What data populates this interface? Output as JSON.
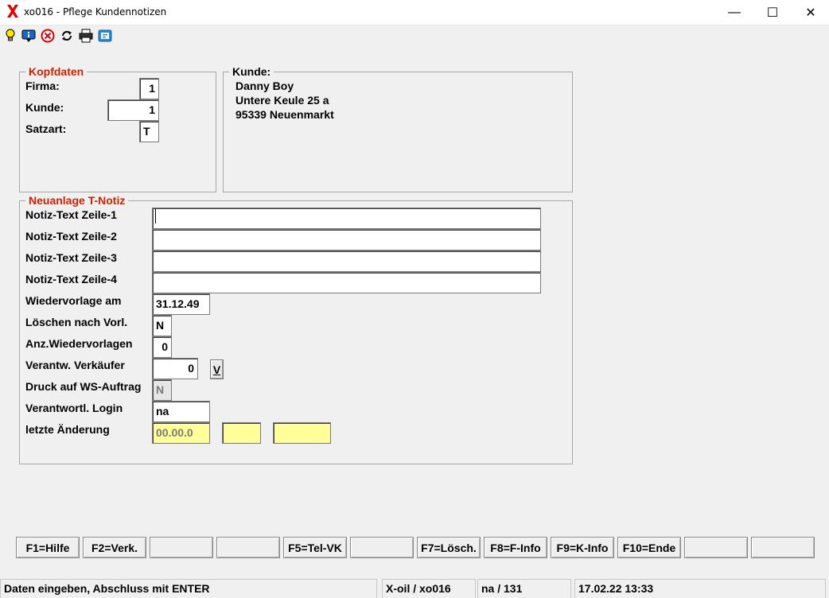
{
  "window": {
    "title": "xo016 - Pflege Kundennotizen",
    "minimize_glyph": "—",
    "maximize_glyph": "☐",
    "close_glyph": "✕"
  },
  "toolbar": {
    "icons": [
      "lightbulb-icon",
      "info-screen-icon",
      "cancel-icon",
      "refresh-icon",
      "print-icon",
      "help-window-icon"
    ]
  },
  "kopfdaten": {
    "legend": "Kopfdaten",
    "firma_label": "Firma:",
    "firma_value": "1",
    "kunde_label": "Kunde:",
    "kunde_value": "1",
    "satzart_label": "Satzart:",
    "satzart_value": "T"
  },
  "kunde": {
    "legend": "Kunde:",
    "name": "Danny Boy",
    "street": "Untere Keule 25 a",
    "city": "95339 Neuenmarkt"
  },
  "notiz": {
    "legend": "Neuanlage T-Notiz",
    "zeile1_label": "Notiz-Text Zeile-1",
    "zeile1_value": "",
    "zeile2_label": "Notiz-Text Zeile-2",
    "zeile2_value": "",
    "zeile3_label": "Notiz-Text Zeile-3",
    "zeile3_value": "",
    "zeile4_label": "Notiz-Text Zeile-4",
    "zeile4_value": "",
    "wiedervorlage_label": "Wiedervorlage am",
    "wiedervorlage_value": "31.12.49",
    "loeschen_label": "Löschen nach Vorl.",
    "loeschen_value": "N",
    "anz_label": "Anz.Wiedervorlagen",
    "anz_value": "0",
    "verkaeufer_label": "Verantw. Verkäufer",
    "verkaeufer_value": "0",
    "verkaeufer_button": "V",
    "druck_label": "Druck auf WS-Auftrag",
    "druck_value": "N",
    "login_label": "Verantwortl. Login",
    "login_value": "na",
    "aenderung_label": "letzte Änderung",
    "aenderung_date": "00.00.0",
    "aenderung_time": "",
    "aenderung_user": ""
  },
  "fkeys": [
    "F1=Hilfe",
    "F2=Verk.",
    "",
    "",
    "F5=Tel-VK",
    "",
    "F7=Lösch.",
    "F8=F-Info",
    "F9=K-Info",
    "F10=Ende",
    "",
    ""
  ],
  "statusbar": {
    "message": "Daten eingeben, Abschluss mit ENTER",
    "program": "X-oil / xo016",
    "user": "na / 131",
    "datetime": "17.02.22 13:33"
  },
  "colors": {
    "legend_red": "#d02000",
    "readonly_yellow": "#ffff99",
    "logo_red": "#e00000"
  }
}
